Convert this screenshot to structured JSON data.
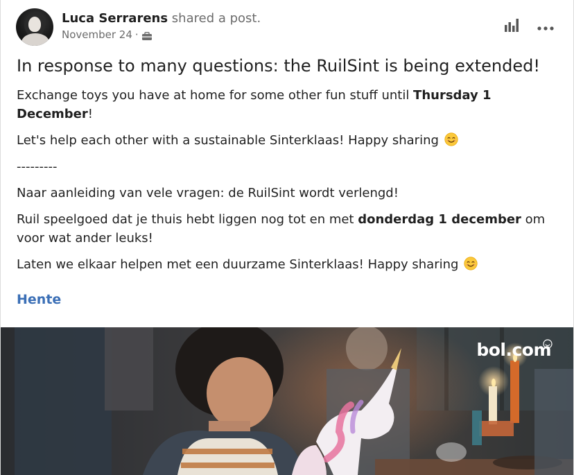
{
  "post": {
    "author": "Luca Serrarens",
    "action": "shared a post.",
    "date": "November 24",
    "dot": "·",
    "title": "In response to many questions: the RuilSint is being extended!",
    "p1_before": "Exchange toys you have at home for some other fun stuff until ",
    "p1_bold": "Thursday 1 December",
    "p1_after": "!",
    "p2": "Let's help each other with a sustainable Sinterklaas! Happy sharing",
    "separator": "---------",
    "p3": "Naar aanleiding van vele vragen: de RuilSint wordt verlengd!",
    "p4_before": "Ruil speelgoed dat je thuis hebt liggen nog tot en met ",
    "p4_bold": "donderdag 1 december",
    "p4_after": " om voor wat ander leuks!",
    "p5": "Laten we elkaar helpen met een duurzame Sinterklaas! Happy sharing",
    "link_label": "Hente"
  },
  "media": {
    "brand": "bol.com"
  },
  "icons": {
    "analytics": "bar-chart-icon",
    "more": "more-horizontal-icon",
    "visibility": "briefcase-icon",
    "emoji": "smiling-face-emoji"
  },
  "colors": {
    "link": "#3b6fb6",
    "text": "#1f1f1f",
    "muted": "#6b6b6b"
  }
}
